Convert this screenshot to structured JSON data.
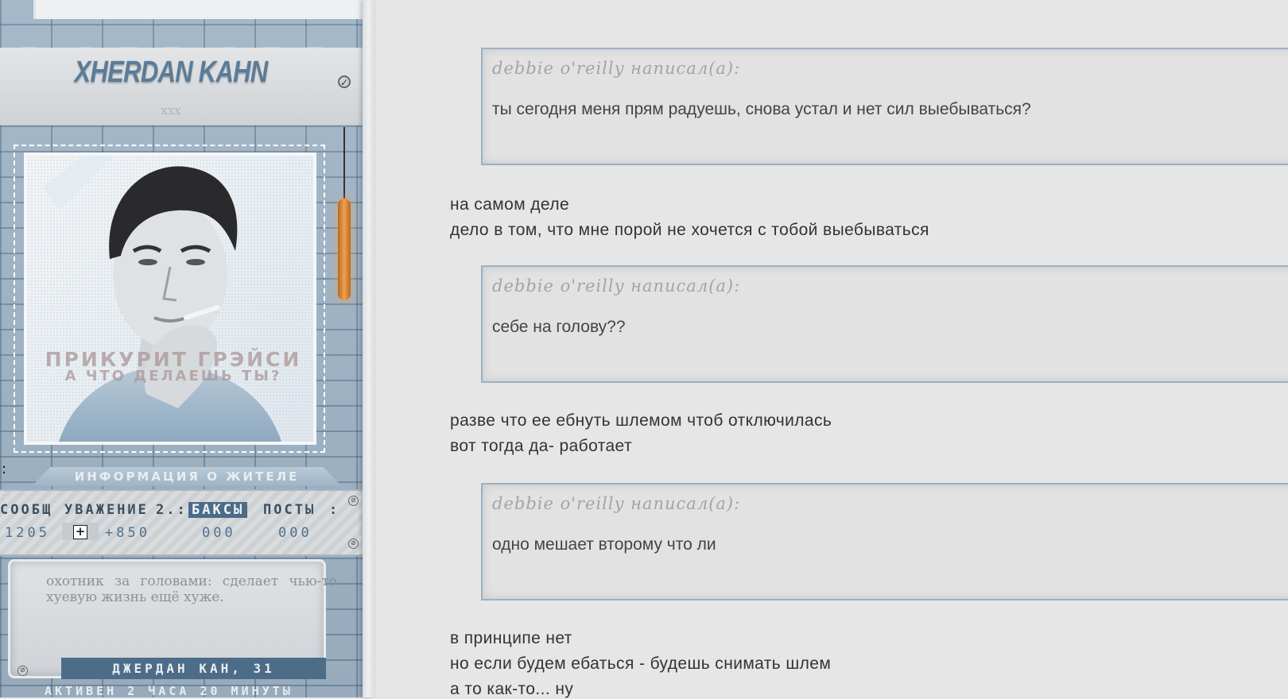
{
  "profile": {
    "name": "XHERDAN KAHN",
    "subtitle": "xxx",
    "avatar_caption_line1": "ПРИКУРИТ ГРЭЙСИ",
    "avatar_caption_line2": "А ЧТО ДЕЛАЕШЬ ТЫ?",
    "stray_colon": ":",
    "info_title": "ИНФОРМАЦИЯ О ЖИТЕЛЕ",
    "stats": {
      "labels": [
        "СООБЩ",
        "УВАЖЕНИЕ",
        "2.:",
        "БАКСЫ",
        "ПОСТЫ",
        ":"
      ],
      "messages": "1205",
      "respect": "+850",
      "bucks": "000",
      "posts": "000",
      "plus_label": "+"
    },
    "bio": "охотник за головами: сделает чью-то хуевую жизнь ещё хуже.",
    "name_age": "ДЖЕРДАН КАН, 31",
    "last_active": "АКТИВЕН 2 ЧАСА 20 МИНУТЫ"
  },
  "post": {
    "quotes": [
      {
        "author": "debbie o'reilly написал(а):",
        "text": "ты сегодня меня прям радуешь, снова устал и нет сил выебываться?"
      },
      {
        "author": "debbie o'reilly написал(а):",
        "text": "себе на голову??"
      },
      {
        "author": "debbie o'reilly написал(а):",
        "text": "одно мешает второму что ли"
      }
    ],
    "replies": [
      [
        "на самом деле",
        "дело в том, что мне порой не хочется с тобой выебываться"
      ],
      [
        "разве что ее ебнуть шлемом чтоб отключилась",
        "вот тогда да- работает"
      ],
      [
        "в принципе нет",
        "но если будем ебаться - будешь снимать шлем",
        "а то как-то... ну"
      ]
    ]
  },
  "colors": {
    "accent": "#4c6c88",
    "name": "#5b7c97",
    "quote_border": "#9cb0c4",
    "page_bg": "#e6e6e6"
  },
  "icons": [
    "pin-icon",
    "screw-icon",
    "plus-icon"
  ]
}
